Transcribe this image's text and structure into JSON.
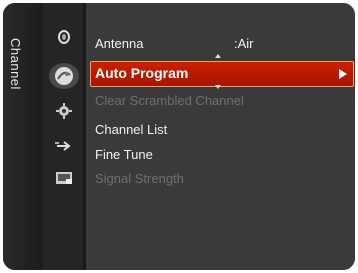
{
  "side_tab": {
    "label": "Channel"
  },
  "menu": {
    "items": [
      {
        "label": "Antenna",
        "value": ":Air"
      },
      {
        "label": "Auto Program"
      },
      {
        "label": "Clear Scrambled Channel"
      },
      {
        "label": "Channel List"
      },
      {
        "label": "Fine Tune"
      },
      {
        "label": "Signal Strength"
      }
    ],
    "selected_index": 1
  },
  "icons": [
    "picture-icon",
    "channel-icon",
    "setup-icon",
    "input-icon",
    "application-icon"
  ],
  "colors": {
    "highlight": "#c11c00",
    "highlight_border": "#f0a060",
    "disabled_text": "#6f6f6f"
  }
}
